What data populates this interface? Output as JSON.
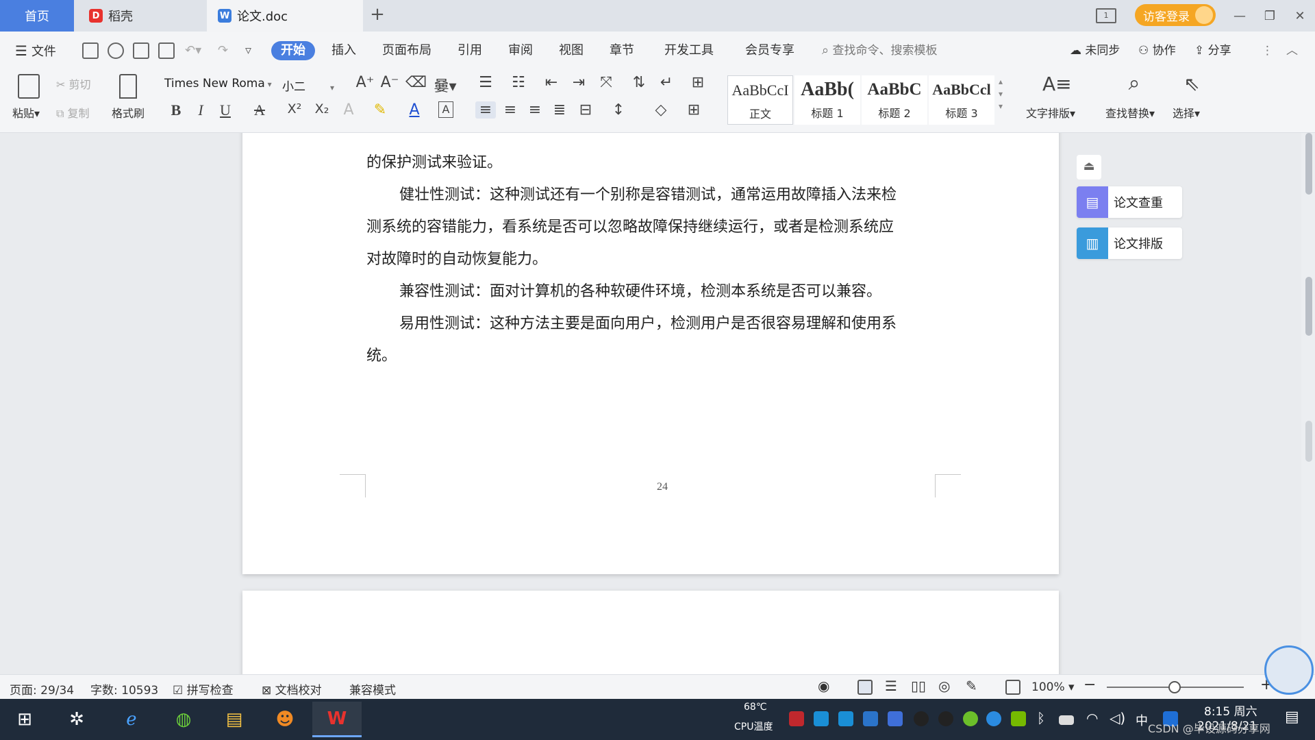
{
  "tabs": {
    "home": "首页",
    "daoke": "稻壳",
    "doc": "论文.doc",
    "add": "+"
  },
  "titlebar": {
    "guest_login": "访客登录",
    "layout_icon": "1"
  },
  "menu": {
    "file": "文件",
    "items": [
      "开始",
      "插入",
      "页面布局",
      "引用",
      "审阅",
      "视图",
      "章节",
      "开发工具",
      "会员专享"
    ],
    "search_placeholder": "查找命令、搜索模板",
    "not_synced": "未同步",
    "collaborate": "协作",
    "share": "分享"
  },
  "ribbon": {
    "paste": "粘贴",
    "cut": "剪切",
    "copy": "复制",
    "format_painter": "格式刷",
    "font_name": "Times New Roma",
    "font_size": "小二",
    "bold": "B",
    "italic": "I",
    "underline": "U",
    "strike": "A",
    "superscript": "X²",
    "subscript": "X₂",
    "styles": [
      {
        "sample": "AaBbCcI",
        "name": "正文"
      },
      {
        "sample": "AaBb(",
        "name": "标题 1"
      },
      {
        "sample": "AaBbC",
        "name": "标题 2"
      },
      {
        "sample": "AaBbCcl",
        "name": "标题 3"
      }
    ],
    "text_layout": "文字排版",
    "find_replace": "查找替换",
    "select": "选择"
  },
  "document": {
    "paragraphs": [
      "的保护测试来验证。",
      "健壮性测试：这种测试还有一个别称是容错测试，通常运用故障插入法来检",
      "测系统的容错能力，看系统是否可以忽略故障保持继续运行，或者是检测系统应",
      "对故障时的自动恢复能力。",
      "兼容性测试：面对计算机的各种软硬件环境，检测本系统是否可以兼容。",
      "易用性测试：这种方法主要是面向用户，检测用户是否很容易理解和使用系",
      "统。"
    ],
    "page_number": "24"
  },
  "side_panel": {
    "check": "论文查重",
    "layout": "论文排版"
  },
  "status": {
    "page": "页面: 29/34",
    "words": "字数: 10593",
    "spell_check": "拼写检查",
    "doc_proof": "文档校对",
    "compat_mode": "兼容模式",
    "zoom": "100%",
    "zoom_level": 1.0
  },
  "taskbar": {
    "temp": "68℃",
    "cpu_label": "CPU温度",
    "ime": "中",
    "time": "8:15 周六",
    "date": "2021/8/21",
    "watermark": "CSDN @毕设源码分享网"
  },
  "colors": {
    "accent": "#4a7fe0",
    "guest_login": "#f5a623",
    "taskbar": "#1f2b3a",
    "wps_red": "#e8322e"
  }
}
